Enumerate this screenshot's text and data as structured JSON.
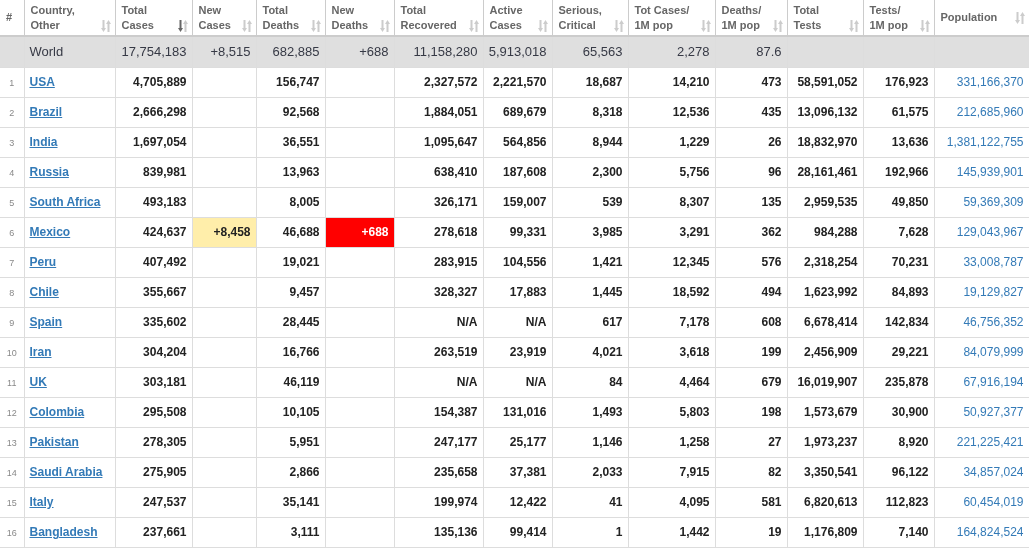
{
  "table": {
    "columns": [
      {
        "label": "#",
        "sortable": false
      },
      {
        "label": "Country,\nOther",
        "sortable": true,
        "sorted": false
      },
      {
        "label": "Total\nCases",
        "sortable": true,
        "sorted": true
      },
      {
        "label": "New\nCases",
        "sortable": true,
        "sorted": false
      },
      {
        "label": "Total\nDeaths",
        "sortable": true,
        "sorted": false
      },
      {
        "label": "New\nDeaths",
        "sortable": true,
        "sorted": false
      },
      {
        "label": "Total\nRecovered",
        "sortable": true,
        "sorted": false
      },
      {
        "label": "Active\nCases",
        "sortable": true,
        "sorted": false
      },
      {
        "label": "Serious,\nCritical",
        "sortable": true,
        "sorted": false
      },
      {
        "label": "Tot Cases/\n1M pop",
        "sortable": true,
        "sorted": false
      },
      {
        "label": "Deaths/\n1M pop",
        "sortable": true,
        "sorted": false
      },
      {
        "label": "Total\nTests",
        "sortable": true,
        "sorted": false
      },
      {
        "label": "Tests/\n1M pop",
        "sortable": true,
        "sorted": false
      },
      {
        "label": "Population",
        "sortable": true,
        "sorted": false
      }
    ],
    "total_row": {
      "country": "World",
      "total_cases": "17,754,183",
      "new_cases": "+8,515",
      "total_deaths": "682,885",
      "new_deaths": "+688",
      "total_recovered": "11,158,280",
      "active_cases": "5,913,018",
      "serious_critical": "65,563",
      "cases_per_1m": "2,278",
      "deaths_per_1m": "87.6"
    },
    "rows": [
      {
        "rank": "1",
        "country": "USA",
        "alert": false,
        "total_cases": "4,705,889",
        "total_deaths": "156,747",
        "total_recovered": "2,327,572",
        "active_cases": "2,221,570",
        "serious_critical": "18,687",
        "cases_per_1m": "14,210",
        "deaths_per_1m": "473",
        "total_tests": "58,591,052",
        "tests_per_1m": "176,923",
        "population": "331,166,370"
      },
      {
        "rank": "2",
        "country": "Brazil",
        "alert": false,
        "total_cases": "2,666,298",
        "total_deaths": "92,568",
        "total_recovered": "1,884,051",
        "active_cases": "689,679",
        "serious_critical": "8,318",
        "cases_per_1m": "12,536",
        "deaths_per_1m": "435",
        "total_tests": "13,096,132",
        "tests_per_1m": "61,575",
        "population": "212,685,960"
      },
      {
        "rank": "3",
        "country": "India",
        "alert": false,
        "total_cases": "1,697,054",
        "total_deaths": "36,551",
        "total_recovered": "1,095,647",
        "active_cases": "564,856",
        "serious_critical": "8,944",
        "cases_per_1m": "1,229",
        "deaths_per_1m": "26",
        "total_tests": "18,832,970",
        "tests_per_1m": "13,636",
        "population": "1,381,122,755"
      },
      {
        "rank": "4",
        "country": "Russia",
        "alert": false,
        "total_cases": "839,981",
        "total_deaths": "13,963",
        "total_recovered": "638,410",
        "active_cases": "187,608",
        "serious_critical": "2,300",
        "cases_per_1m": "5,756",
        "deaths_per_1m": "96",
        "total_tests": "28,161,461",
        "tests_per_1m": "192,966",
        "population": "145,939,901"
      },
      {
        "rank": "5",
        "country": "South Africa",
        "alert": false,
        "total_cases": "493,183",
        "total_deaths": "8,005",
        "total_recovered": "326,171",
        "active_cases": "159,007",
        "serious_critical": "539",
        "cases_per_1m": "8,307",
        "deaths_per_1m": "135",
        "total_tests": "2,959,535",
        "tests_per_1m": "49,850",
        "population": "59,369,309"
      },
      {
        "rank": "6",
        "country": "Mexico",
        "alert": true,
        "total_cases": "424,637",
        "new_cases": "+8,458",
        "total_deaths": "46,688",
        "new_deaths": "+688",
        "total_recovered": "278,618",
        "active_cases": "99,331",
        "serious_critical": "3,985",
        "cases_per_1m": "3,291",
        "deaths_per_1m": "362",
        "total_tests": "984,288",
        "tests_per_1m": "7,628",
        "population": "129,043,967"
      },
      {
        "rank": "7",
        "country": "Peru",
        "alert": false,
        "total_cases": "407,492",
        "total_deaths": "19,021",
        "total_recovered": "283,915",
        "active_cases": "104,556",
        "serious_critical": "1,421",
        "cases_per_1m": "12,345",
        "deaths_per_1m": "576",
        "total_tests": "2,318,254",
        "tests_per_1m": "70,231",
        "population": "33,008,787"
      },
      {
        "rank": "8",
        "country": "Chile",
        "alert": false,
        "total_cases": "355,667",
        "total_deaths": "9,457",
        "total_recovered": "328,327",
        "active_cases": "17,883",
        "serious_critical": "1,445",
        "cases_per_1m": "18,592",
        "deaths_per_1m": "494",
        "total_tests": "1,623,992",
        "tests_per_1m": "84,893",
        "population": "19,129,827"
      },
      {
        "rank": "9",
        "country": "Spain",
        "alert": false,
        "total_cases": "335,602",
        "total_deaths": "28,445",
        "total_recovered": "N/A",
        "active_cases": "N/A",
        "serious_critical": "617",
        "cases_per_1m": "7,178",
        "deaths_per_1m": "608",
        "total_tests": "6,678,414",
        "tests_per_1m": "142,834",
        "population": "46,756,352"
      },
      {
        "rank": "10",
        "country": "Iran",
        "alert": false,
        "total_cases": "304,204",
        "total_deaths": "16,766",
        "total_recovered": "263,519",
        "active_cases": "23,919",
        "serious_critical": "4,021",
        "cases_per_1m": "3,618",
        "deaths_per_1m": "199",
        "total_tests": "2,456,909",
        "tests_per_1m": "29,221",
        "population": "84,079,999"
      },
      {
        "rank": "11",
        "country": "UK",
        "alert": false,
        "total_cases": "303,181",
        "total_deaths": "46,119",
        "total_recovered": "N/A",
        "active_cases": "N/A",
        "serious_critical": "84",
        "cases_per_1m": "4,464",
        "deaths_per_1m": "679",
        "total_tests": "16,019,907",
        "tests_per_1m": "235,878",
        "population": "67,916,194"
      },
      {
        "rank": "12",
        "country": "Colombia",
        "alert": false,
        "total_cases": "295,508",
        "total_deaths": "10,105",
        "total_recovered": "154,387",
        "active_cases": "131,016",
        "serious_critical": "1,493",
        "cases_per_1m": "5,803",
        "deaths_per_1m": "198",
        "total_tests": "1,573,679",
        "tests_per_1m": "30,900",
        "population": "50,927,377"
      },
      {
        "rank": "13",
        "country": "Pakistan",
        "alert": false,
        "total_cases": "278,305",
        "total_deaths": "5,951",
        "total_recovered": "247,177",
        "active_cases": "25,177",
        "serious_critical": "1,146",
        "cases_per_1m": "1,258",
        "deaths_per_1m": "27",
        "total_tests": "1,973,237",
        "tests_per_1m": "8,920",
        "population": "221,225,421"
      },
      {
        "rank": "14",
        "country": "Saudi Arabia",
        "alert": false,
        "total_cases": "275,905",
        "total_deaths": "2,866",
        "total_recovered": "235,658",
        "active_cases": "37,381",
        "serious_critical": "2,033",
        "cases_per_1m": "7,915",
        "deaths_per_1m": "82",
        "total_tests": "3,350,541",
        "tests_per_1m": "96,122",
        "population": "34,857,024"
      },
      {
        "rank": "15",
        "country": "Italy",
        "alert": false,
        "total_cases": "247,537",
        "total_deaths": "35,141",
        "total_recovered": "199,974",
        "active_cases": "12,422",
        "serious_critical": "41",
        "cases_per_1m": "4,095",
        "deaths_per_1m": "581",
        "total_tests": "6,820,613",
        "tests_per_1m": "112,823",
        "population": "60,454,019"
      },
      {
        "rank": "16",
        "country": "Bangladesh",
        "alert": false,
        "total_cases": "237,661",
        "total_deaths": "3,111",
        "total_recovered": "135,136",
        "active_cases": "99,414",
        "serious_critical": "1",
        "cases_per_1m": "1,442",
        "deaths_per_1m": "19",
        "total_tests": "1,176,809",
        "tests_per_1m": "7,140",
        "population": "164,824,524"
      }
    ]
  }
}
